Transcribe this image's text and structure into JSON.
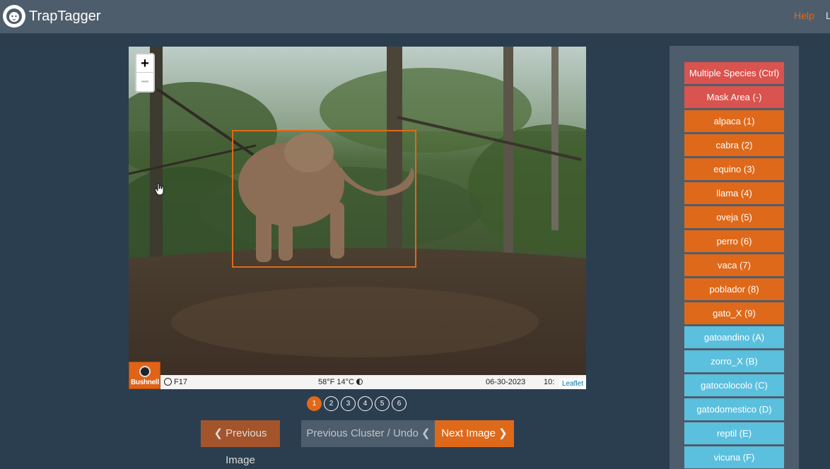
{
  "navbar": {
    "brand": "TrapTagger",
    "help": "Help",
    "extra": "L"
  },
  "viewer": {
    "zoom_in": "+",
    "zoom_out": "−",
    "camera_brand": "Bushnell",
    "info_camera": "F17",
    "info_temp": "58°F 14°C",
    "info_date": "06-30-2023",
    "info_time": "10:",
    "attribution": "Leaflet"
  },
  "pager": [
    "1",
    "2",
    "3",
    "4",
    "5",
    "6"
  ],
  "buttons": {
    "prev": "❮ Previous Image",
    "undo": "Previous Cluster / Undo ❮",
    "next": "Next Image ❯"
  },
  "species": [
    {
      "label": "Multiple Species (Ctrl)",
      "style": "red"
    },
    {
      "label": "Mask Area (-)",
      "style": "red"
    },
    {
      "label": "alpaca (1)",
      "style": "orange"
    },
    {
      "label": "cabra (2)",
      "style": "orange"
    },
    {
      "label": "equino (3)",
      "style": "orange"
    },
    {
      "label": "llama (4)",
      "style": "orange"
    },
    {
      "label": "oveja (5)",
      "style": "orange"
    },
    {
      "label": "perro (6)",
      "style": "orange"
    },
    {
      "label": "vaca (7)",
      "style": "orange"
    },
    {
      "label": "poblador (8)",
      "style": "orange"
    },
    {
      "label": "gato_X (9)",
      "style": "orange"
    },
    {
      "label": "gatoandino (A)",
      "style": "blue"
    },
    {
      "label": "zorro_X (B)",
      "style": "blue"
    },
    {
      "label": "gatocolocolo (C)",
      "style": "blue"
    },
    {
      "label": "gatodomestico (D)",
      "style": "blue"
    },
    {
      "label": "reptil (E)",
      "style": "blue"
    },
    {
      "label": "vicuna (F)",
      "style": "blue"
    }
  ],
  "colors": {
    "background": "#2b3e50",
    "navbar": "#4e5d6c",
    "accent": "#df691a",
    "danger": "#d9534f",
    "info": "#5bc0de"
  }
}
